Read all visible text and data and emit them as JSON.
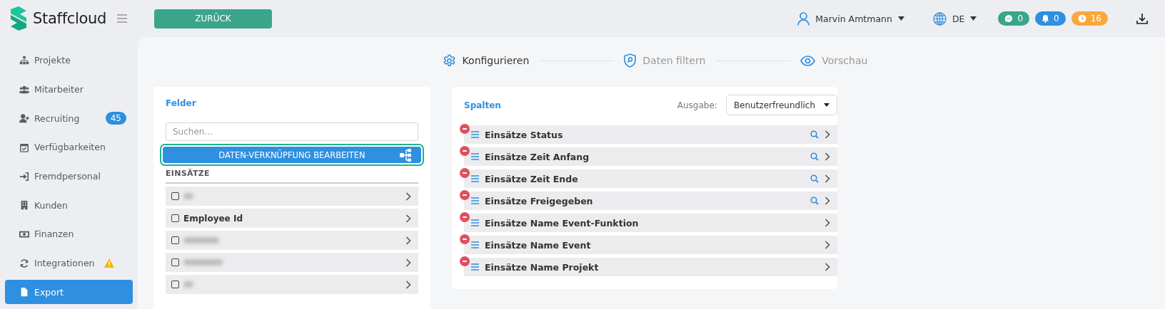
{
  "logo": {
    "name": "Staffcloud"
  },
  "back_button": "ZURÜCK",
  "user": {
    "name": "Marvin Amtmann"
  },
  "language": "DE",
  "badges": [
    {
      "kind": "chat",
      "count": "0",
      "color": "#3aa58a"
    },
    {
      "kind": "bell",
      "count": "0",
      "color": "#2f8fe0"
    },
    {
      "kind": "clock",
      "count": "16",
      "color": "#f9a83c"
    }
  ],
  "sidebar": {
    "items": [
      {
        "kind": "projects",
        "label": "Projekte",
        "selected": false
      },
      {
        "kind": "people",
        "label": "Mitarbeiter",
        "selected": false
      },
      {
        "kind": "recruit",
        "label": "Recruiting",
        "badge": "45",
        "selected": false
      },
      {
        "kind": "calendar",
        "label": "Verfügbarkeiten",
        "selected": false
      },
      {
        "kind": "enter",
        "label": "Fremdpersonal",
        "selected": false
      },
      {
        "kind": "building",
        "label": "Kunden",
        "selected": false
      },
      {
        "kind": "money",
        "label": "Finanzen",
        "selected": false
      },
      {
        "kind": "sync",
        "label": "Integrationen",
        "warning": true,
        "selected": false
      },
      {
        "kind": "file",
        "label": "Export",
        "selected": true
      }
    ]
  },
  "steps": [
    {
      "kind": "gear",
      "label": "Konfigurieren",
      "selected": true
    },
    {
      "kind": "shield",
      "label": "Daten filtern",
      "selected": false
    },
    {
      "kind": "eye",
      "label": "Vorschau",
      "selected": false
    }
  ],
  "fields_panel": {
    "title": "Felder",
    "search": {
      "placeholder": "Suchen..."
    },
    "link_button": "DATEN-VERKNÜPFUNG BEARBEITEN",
    "group": "EINSÄTZE",
    "fields": [
      {
        "kind": "blurred",
        "checked": false
      },
      {
        "kind": "text",
        "label": "Employee Id",
        "checked": false
      },
      {
        "kind": "blurred",
        "checked": false
      },
      {
        "kind": "blurred",
        "checked": false
      },
      {
        "kind": "blurred",
        "checked": false
      }
    ]
  },
  "columns_panel": {
    "title": "Spalten",
    "output_label": "Ausgabe:",
    "output_value": "Benutzerfreundlich",
    "columns": [
      {
        "label": "Einsätze Status",
        "filterable": true
      },
      {
        "label": "Einsätze Zeit Anfang",
        "filterable": true
      },
      {
        "label": "Einsätze Zeit Ende",
        "filterable": true
      },
      {
        "label": "Einsätze Freigegeben",
        "filterable": true
      },
      {
        "label": "Einsätze Name Event-Funktion",
        "filterable": false
      },
      {
        "label": "Einsätze Name Event",
        "filterable": false
      },
      {
        "label": "Einsätze Name Projekt",
        "filterable": false
      }
    ]
  }
}
